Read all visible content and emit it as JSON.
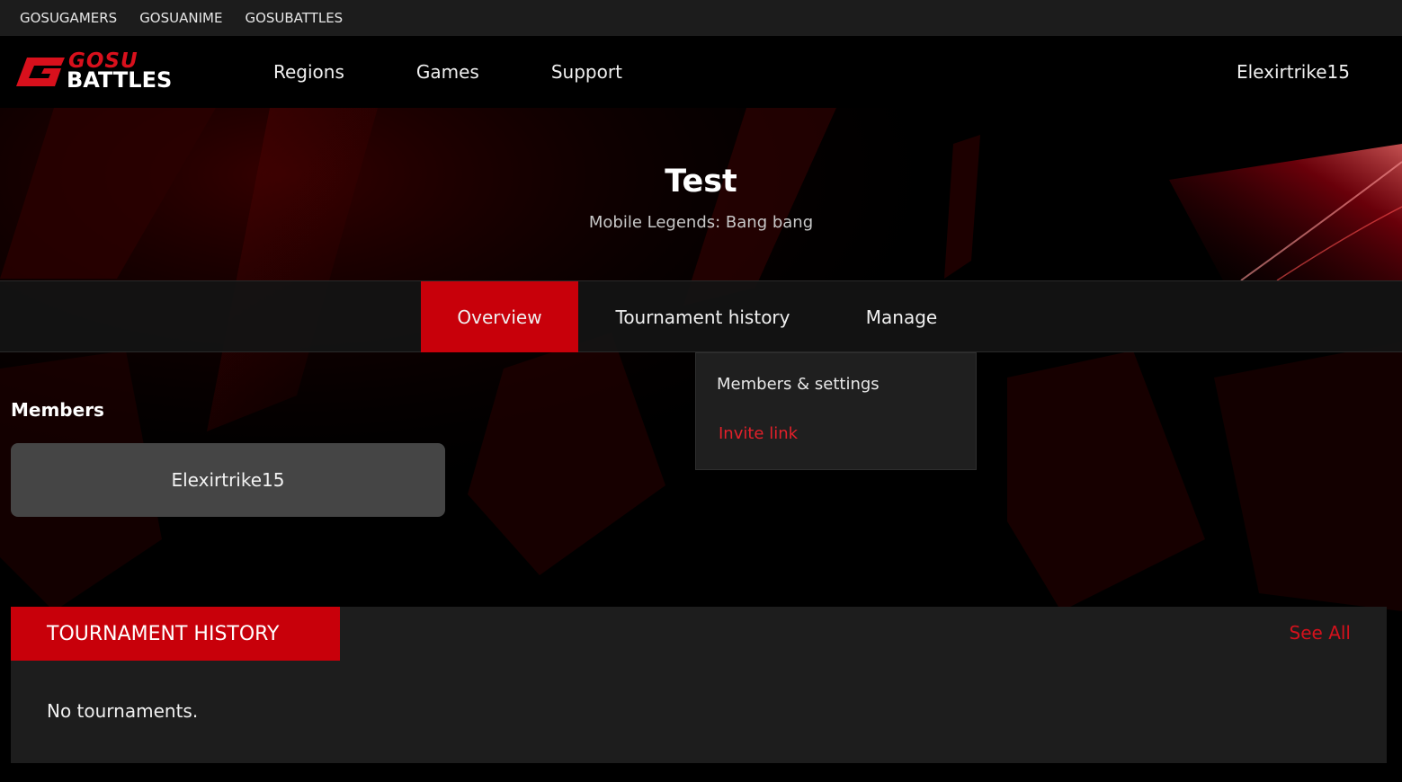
{
  "topstrip": {
    "links": [
      "GOSUGAMERS",
      "GOSUANIME",
      "GOSUBATTLES"
    ]
  },
  "header": {
    "logo": {
      "line1": "GOSU",
      "line2": "BATTLES"
    },
    "nav": [
      "Regions",
      "Games",
      "Support"
    ],
    "username": "Elexirtrike15"
  },
  "hero": {
    "team_name": "Test",
    "game": "Mobile Legends: Bang bang"
  },
  "tabs": {
    "items": [
      {
        "label": "Overview",
        "active": true
      },
      {
        "label": "Tournament history",
        "active": false
      },
      {
        "label": "Manage",
        "active": false
      }
    ]
  },
  "manage_dropdown": {
    "items": [
      "Members & settings",
      "Invite link"
    ]
  },
  "members": {
    "title": "Members",
    "list": [
      "Elexirtrike15"
    ]
  },
  "tournament_history": {
    "title": "TOURNAMENT HISTORY",
    "see_all": "See All",
    "empty_text": "No tournaments."
  },
  "colors": {
    "accent_red": "#c8000a",
    "link_red": "#e3202a",
    "panel_bg": "#1d1d1d",
    "card_bg": "#454545"
  }
}
